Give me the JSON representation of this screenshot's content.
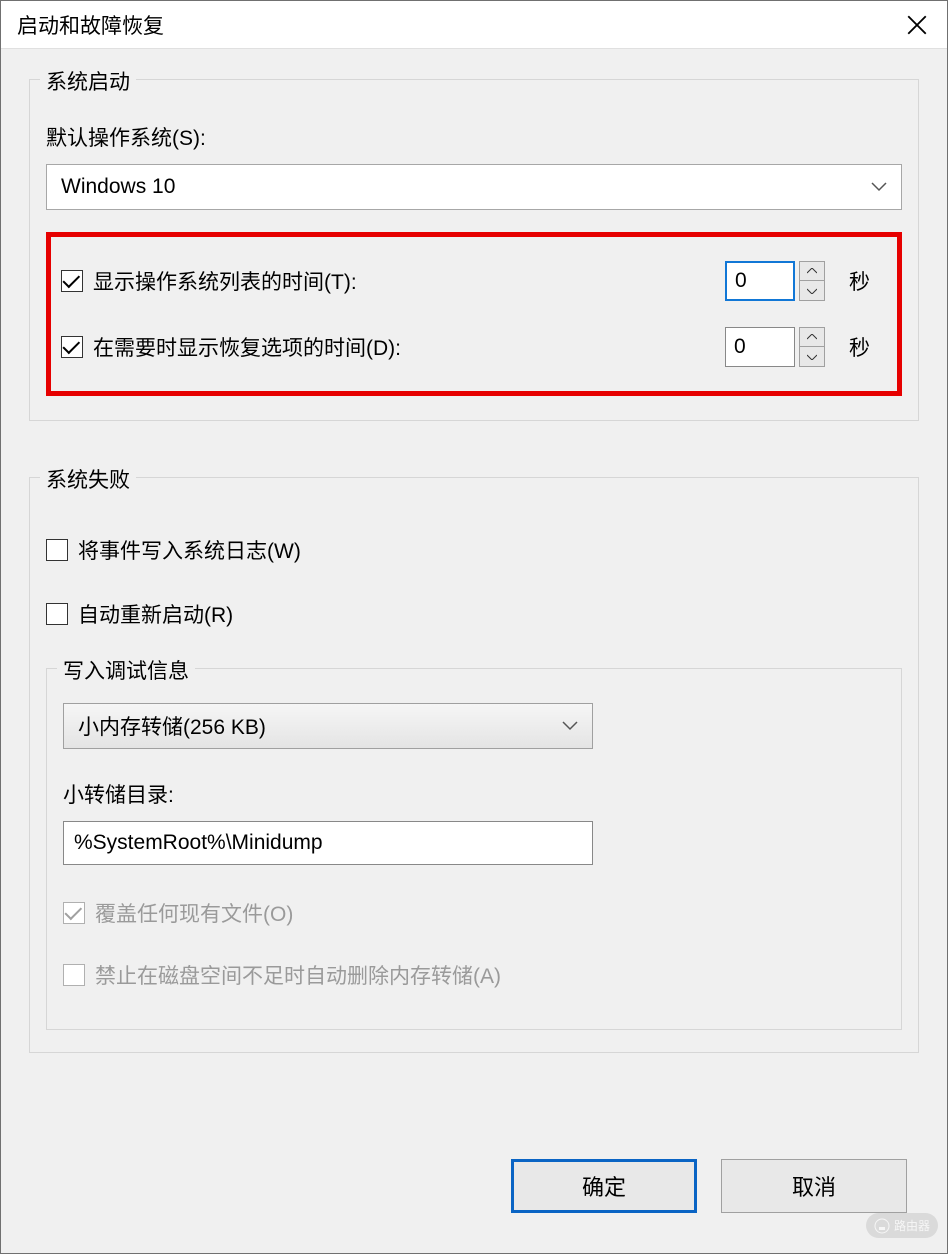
{
  "title": "启动和故障恢复",
  "group1": {
    "legend": "系统启动",
    "default_os_label": "默认操作系统(S):",
    "default_os_value": "Windows 10",
    "show_os_list": {
      "label": "显示操作系统列表的时间(T):",
      "value": "0",
      "unit": "秒",
      "checked": true
    },
    "show_recovery": {
      "label": "在需要时显示恢复选项的时间(D):",
      "value": "0",
      "unit": "秒",
      "checked": true
    }
  },
  "group2": {
    "legend": "系统失败",
    "write_event": {
      "label": "将事件写入系统日志(W)",
      "checked": false
    },
    "auto_restart": {
      "label": "自动重新启动(R)",
      "checked": false
    },
    "debug": {
      "legend": "写入调试信息",
      "dump_type": "小内存转储(256 KB)",
      "dump_dir_label": "小转储目录:",
      "dump_dir_value": "%SystemRoot%\\Minidump",
      "overwrite": {
        "label": "覆盖任何现有文件(O)",
        "checked": true
      },
      "no_auto_delete": {
        "label": "禁止在磁盘空间不足时自动删除内存转储(A)",
        "checked": false
      }
    }
  },
  "buttons": {
    "ok": "确定",
    "cancel": "取消"
  },
  "watermark": "路由器"
}
